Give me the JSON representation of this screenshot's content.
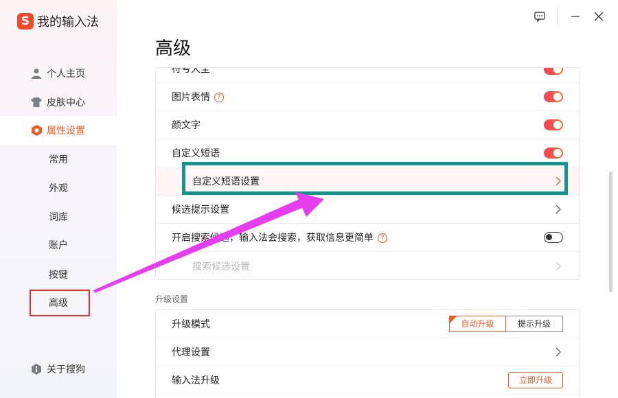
{
  "app": {
    "logo_letter": "S",
    "title": "我的输入法"
  },
  "colors": {
    "accent": "#f05a23",
    "toggle_on": "#f8415a",
    "annotation_teal": "#14948f",
    "annotation_red": "#e0302c",
    "annotation_arrow": "#e83cf0"
  },
  "sidebar": {
    "items": [
      {
        "label": "个人主页",
        "icon": "person-icon"
      },
      {
        "label": "皮肤中心",
        "icon": "tshirt-icon"
      },
      {
        "label": "属性设置",
        "icon": "hexagon-gear-icon",
        "active": true
      }
    ],
    "sub_items": [
      "常用",
      "外观",
      "词库",
      "账户",
      "按键",
      "高级"
    ],
    "selected_sub": "高级",
    "footer": {
      "label": "关于搜狗",
      "icon": "info-icon"
    }
  },
  "window_controls": [
    "feedback-icon",
    "minimize-icon",
    "close-icon"
  ],
  "page": {
    "title": "高级"
  },
  "card1": {
    "rows": [
      {
        "label": "符号大全",
        "control": "toggle",
        "state": "on",
        "partially_visible": true
      },
      {
        "label": "图片表情",
        "help": "?",
        "control": "toggle",
        "state": "on"
      },
      {
        "label": "颜文字",
        "control": "toggle",
        "state": "on"
      },
      {
        "label": "自定义短语",
        "control": "toggle",
        "state": "on"
      },
      {
        "label": "自定义短语设置",
        "control": "chevron",
        "sub": true,
        "selected": true
      },
      {
        "label": "候选提示设置",
        "control": "chevron"
      },
      {
        "label": "开启搜索候选，输入法会搜索，获取信息更简单",
        "help": "?",
        "control": "toggle",
        "state": "off"
      },
      {
        "label": "搜索候选设置",
        "control": "chevron",
        "sub": true,
        "disabled": true
      }
    ]
  },
  "upgrade": {
    "section_label": "升级设置",
    "mode_label": "升级模式",
    "mode_options": [
      "自动升级",
      "提示升级"
    ],
    "mode_selected": "自动升级",
    "proxy_label": "代理设置",
    "ime_upgrade_label": "输入法升级",
    "ime_upgrade_button": "立即升级"
  }
}
